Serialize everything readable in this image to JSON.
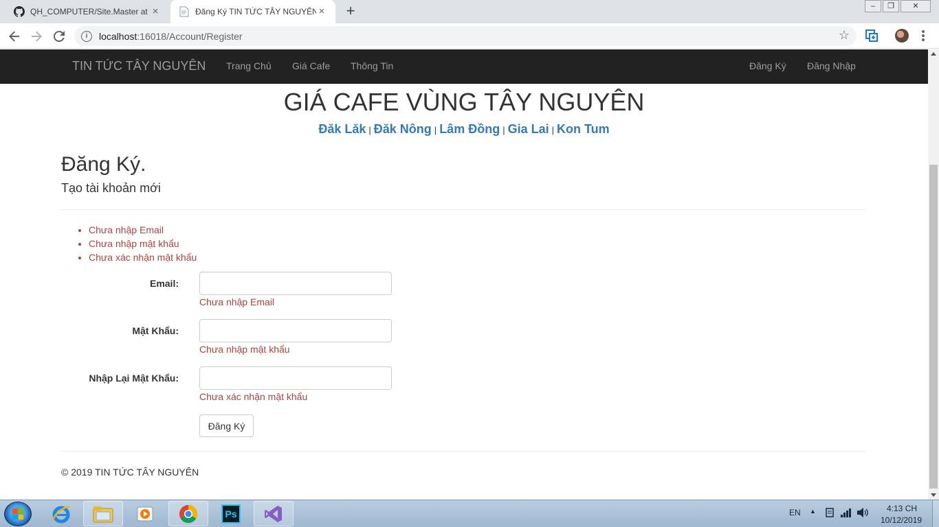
{
  "browser": {
    "tabs": [
      {
        "title": "QH_COMPUTER/Site.Master at m",
        "active": false
      },
      {
        "title": "Đăng Ký TIN TỨC TÂY NGUYÊN",
        "active": true
      }
    ],
    "url_host": "localhost",
    "url_rest": ":16018/Account/Register"
  },
  "navbar": {
    "brand": "TIN TỨC TÂY NGUYÊN",
    "links": [
      "Trang Chủ",
      "Giá Cafe",
      "Thông Tin"
    ],
    "right_links": [
      "Đăng Ký",
      "Đăng Nhập"
    ]
  },
  "header": {
    "title": "GIÁ CAFE VÙNG TÂY NGUYÊN",
    "provinces": [
      "Đăk Lăk",
      "Đăk Nông",
      "Lâm Đồng",
      "Gia Lai",
      "Kon Tum"
    ],
    "separator": "|"
  },
  "page": {
    "heading": "Đăng Ký.",
    "subheading": "Tạo tài khoản mới"
  },
  "validation_summary": [
    "Chưa nhập Email",
    "Chưa nhập mật khẩu",
    "Chưa xác nhận mật khẩu"
  ],
  "form": {
    "email_label": "Email:",
    "email_value": "",
    "email_error": "Chưa nhập Email",
    "password_label": "Mật Khẩu:",
    "password_value": "",
    "password_error": "Chưa nhập mật khẩu",
    "confirm_label": "Nhập Lại Mật Khẩu:",
    "confirm_value": "",
    "confirm_error": "Chưa xác nhận mật khẩu",
    "submit_label": "Đăng Ký"
  },
  "footer": {
    "text": "© 2019 TIN TỨC TÂY NGUYÊN"
  },
  "taskbar": {
    "language": "EN",
    "time": "4:13 CH",
    "date": "10/12/2019",
    "apps": [
      "ie-icon",
      "file-explorer-icon",
      "media-player-icon",
      "chrome-icon",
      "photoshop-icon",
      "visual-studio-icon"
    ],
    "photoshop_label": "Ps"
  },
  "colors": {
    "navbar_bg": "#222222",
    "link_blue": "#337ab7",
    "error_red": "#a94442"
  }
}
